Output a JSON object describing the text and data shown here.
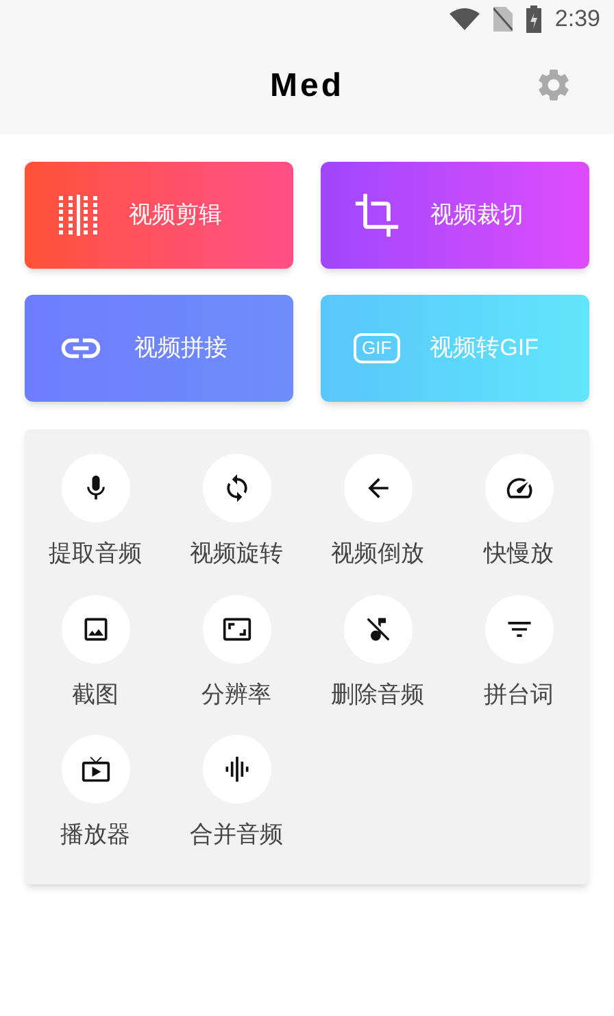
{
  "status_bar": {
    "time": "2:39"
  },
  "header": {
    "title": "Med"
  },
  "feature_cards": [
    {
      "label": "视频剪辑"
    },
    {
      "label": "视频裁切"
    },
    {
      "label": "视频拼接"
    },
    {
      "label": "视频转GIF",
      "icon_text": "GIF"
    }
  ],
  "tools": [
    {
      "label": "提取音频"
    },
    {
      "label": "视频旋转"
    },
    {
      "label": "视频倒放"
    },
    {
      "label": "快慢放"
    },
    {
      "label": "截图"
    },
    {
      "label": "分辨率"
    },
    {
      "label": "删除音频"
    },
    {
      "label": "拼台词"
    },
    {
      "label": "播放器"
    },
    {
      "label": "合并音频"
    }
  ]
}
